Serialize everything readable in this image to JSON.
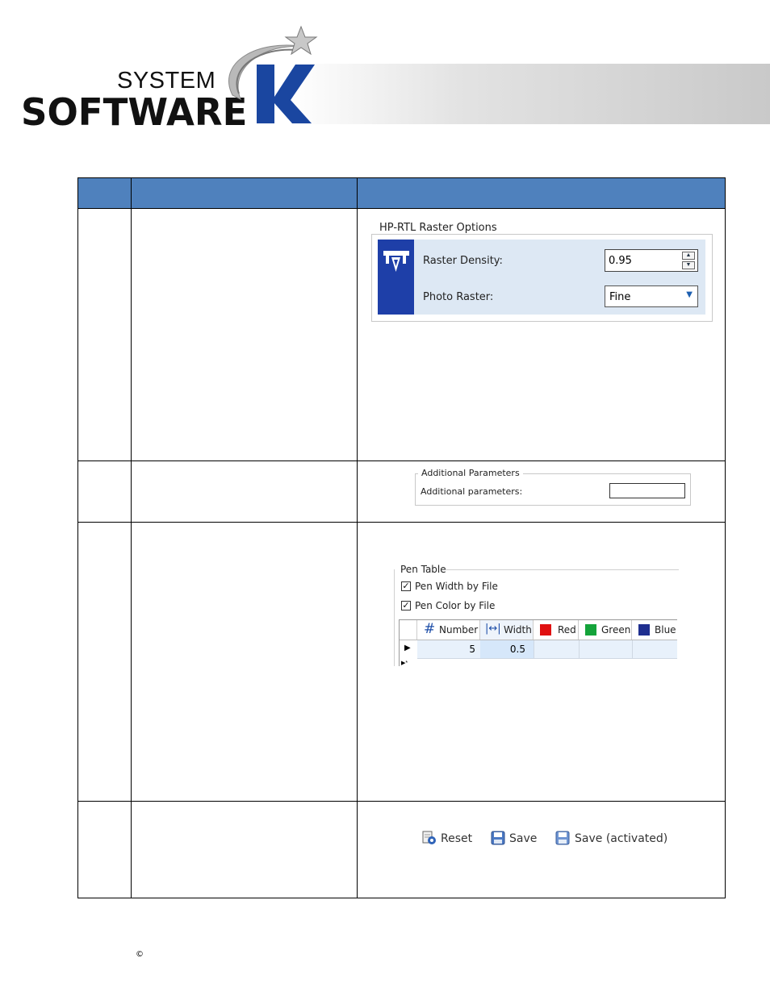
{
  "logo": {
    "line1": "SYSTEM",
    "line2": "SOFTWARE",
    "letter": "K",
    "brand_color": "#1a46a0",
    "banner_gray": "#c9c9c9"
  },
  "table": {
    "header_color": "#4f81bd",
    "headers": [
      "",
      "",
      ""
    ]
  },
  "raster_options": {
    "group_title": "HP-RTL Raster Options",
    "density_label": "Raster Density:",
    "density_value": "0.95",
    "photo_label": "Photo Raster:",
    "photo_value": "Fine",
    "panel_color": "#dde8f4",
    "icon_bar_color": "#1e3fa8"
  },
  "additional": {
    "group_title": "Additional Parameters",
    "field_label": "Additional parameters:",
    "field_value": ""
  },
  "pen_table": {
    "group_title": "Pen Table",
    "pen_width_label": "Pen Width by File",
    "pen_width_checked": true,
    "pen_color_label": "Pen Color by File",
    "pen_color_checked": true,
    "columns": [
      {
        "label": "Number",
        "icon": "hash-icon"
      },
      {
        "label": "Width",
        "icon": "width-arrows-icon"
      },
      {
        "label": "Red",
        "icon": "red-swatch-icon",
        "color": "#e01010"
      },
      {
        "label": "Green",
        "icon": "green-swatch-icon",
        "color": "#14a33a"
      },
      {
        "label": "Blue",
        "icon": "blue-swatch-icon",
        "color": "#1f2f8f"
      }
    ],
    "rows": [
      {
        "number": "5",
        "width": "0.5",
        "red": "",
        "green": "",
        "blue": ""
      }
    ]
  },
  "toolbar": {
    "reset_label": "Reset",
    "save_label": "Save",
    "save_activated_label": "Save (activated)"
  },
  "footer": {
    "copyright": "©"
  }
}
